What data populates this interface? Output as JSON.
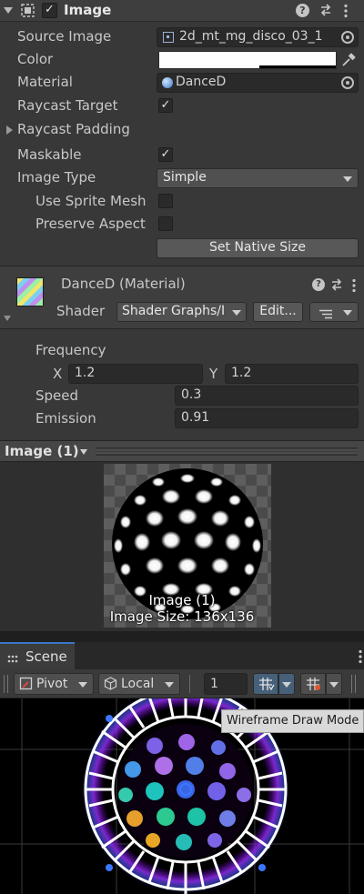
{
  "image_component": {
    "title": "Image",
    "fields": {
      "source_image": {
        "label": "Source Image",
        "value": "2d_mt_mg_disco_03_1"
      },
      "color": {
        "label": "Color"
      },
      "material": {
        "label": "Material",
        "value": "DanceD"
      },
      "raycast_target": {
        "label": "Raycast Target",
        "checked": true,
        "check_glyph": "✓"
      },
      "raycast_padding": {
        "label": "Raycast Padding"
      },
      "maskable": {
        "label": "Maskable",
        "checked": true,
        "check_glyph": "✓"
      },
      "image_type": {
        "label": "Image Type",
        "value": "Simple"
      },
      "use_sprite_mesh": {
        "label": "Use Sprite Mesh",
        "checked": false
      },
      "preserve_aspect": {
        "label": "Preserve Aspect",
        "checked": false
      }
    },
    "set_native_size_label": "Set Native Size"
  },
  "material_section": {
    "title": "DanceD (Material)",
    "shader_label": "Shader",
    "shader_value": "Shader Graphs/I",
    "edit_label": "Edit...",
    "properties": {
      "frequency_label": "Frequency",
      "x_label": "X",
      "x_value": "1.2",
      "y_label": "Y",
      "y_value": "1.2",
      "speed_label": "Speed",
      "speed_value": "0.3",
      "emission_label": "Emission",
      "emission_value": "0.91"
    }
  },
  "preview": {
    "title": "Image (1)",
    "caption_name": "Image (1)",
    "caption_size": "Image Size: 136x136"
  },
  "scene": {
    "tab_label": "Scene",
    "pivot_label": "Pivot",
    "local_label": "Local",
    "snap_value": "1",
    "tooltip": "Wireframe Draw Mode"
  },
  "colors": {
    "accent_blue": "#3a78c9",
    "panel": "#383838",
    "field": "#2a2a2a",
    "neon_purple": "#8a2be2"
  },
  "icons": [
    "foldout-arrow-icon",
    "rect-transform-icon",
    "help-icon",
    "preset-icon",
    "kebab-menu-icon",
    "sprite-icon",
    "object-picker-icon",
    "eyedropper-icon",
    "material-icon",
    "checkmark-icon",
    "shader-list-icon",
    "pivot-icon",
    "local-icon",
    "grid-snap-icon",
    "increment-snap-icon",
    "hamburger-icon"
  ]
}
